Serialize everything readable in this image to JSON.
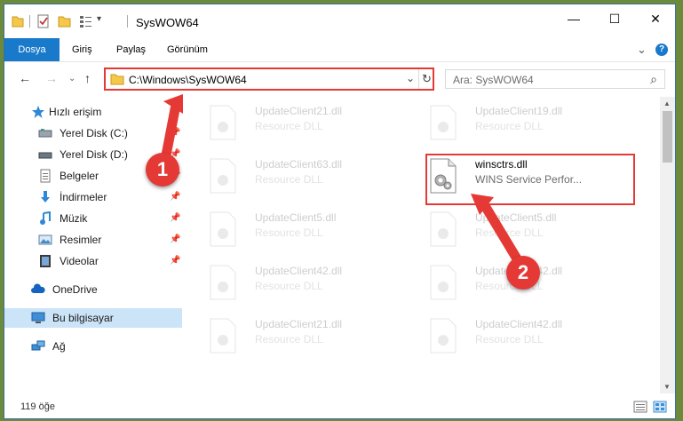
{
  "window": {
    "title": "SysWOW64",
    "minimize": "—",
    "maximize": "☐",
    "close": "✕"
  },
  "ribbon": {
    "tabs": [
      "Dosya",
      "Giriş",
      "Paylaş",
      "Görünüm"
    ],
    "expand": "⌄",
    "help": "?"
  },
  "nav": {
    "back": "←",
    "forward": "→",
    "recent": "⌄",
    "up": "↑",
    "address": "C:\\Windows\\SysWOW64",
    "address_dropdown": "⌄",
    "refresh": "↻",
    "search_placeholder": "Ara: SysWOW64",
    "search_icon": "⌕"
  },
  "sidebar": {
    "items": [
      {
        "label": "Hızlı erişim",
        "icon": "star-icon"
      },
      {
        "label": "Yerel Disk (C:)",
        "icon": "drive-icon"
      },
      {
        "label": "Yerel Disk (D:)",
        "icon": "drive-icon"
      },
      {
        "label": "Belgeler",
        "icon": "documents-icon"
      },
      {
        "label": "İndirmeler",
        "icon": "download-icon"
      },
      {
        "label": "Müzik",
        "icon": "music-icon"
      },
      {
        "label": "Resimler",
        "icon": "pictures-icon"
      },
      {
        "label": "Videolar",
        "icon": "videos-icon"
      },
      {
        "label": "OneDrive",
        "icon": "cloud-icon"
      },
      {
        "label": "Bu bilgisayar",
        "icon": "computer-icon"
      },
      {
        "label": "Ağ",
        "icon": "network-icon"
      }
    ]
  },
  "files": [
    {
      "name": "UpdateClient21.dll",
      "desc": "Resource DLL"
    },
    {
      "name": "UpdateClient19.dll",
      "desc": "Resource DLL"
    },
    {
      "name": "UpdateClient63.dll",
      "desc": "Resource DLL"
    },
    {
      "name": "winsctrs.dll",
      "desc": "WINS Service Perfor..."
    },
    {
      "name": "UpdateClient5.dll",
      "desc": "Resource DLL"
    },
    {
      "name": "UpdateClient5.dll",
      "desc": "Resource DLL"
    },
    {
      "name": "UpdateClient42.dll",
      "desc": "Resource DLL"
    },
    {
      "name": "UpdateClient42.dll",
      "desc": "Resource DLL"
    },
    {
      "name": "UpdateClient21.dll",
      "desc": "Resource DLL"
    },
    {
      "name": "UpdateClient42.dll",
      "desc": "Resource DLL"
    }
  ],
  "status": {
    "count": "119 öğe"
  },
  "callouts": {
    "one": "1",
    "two": "2"
  },
  "colors": {
    "accent": "#1979ca",
    "highlight": "#e53935"
  }
}
